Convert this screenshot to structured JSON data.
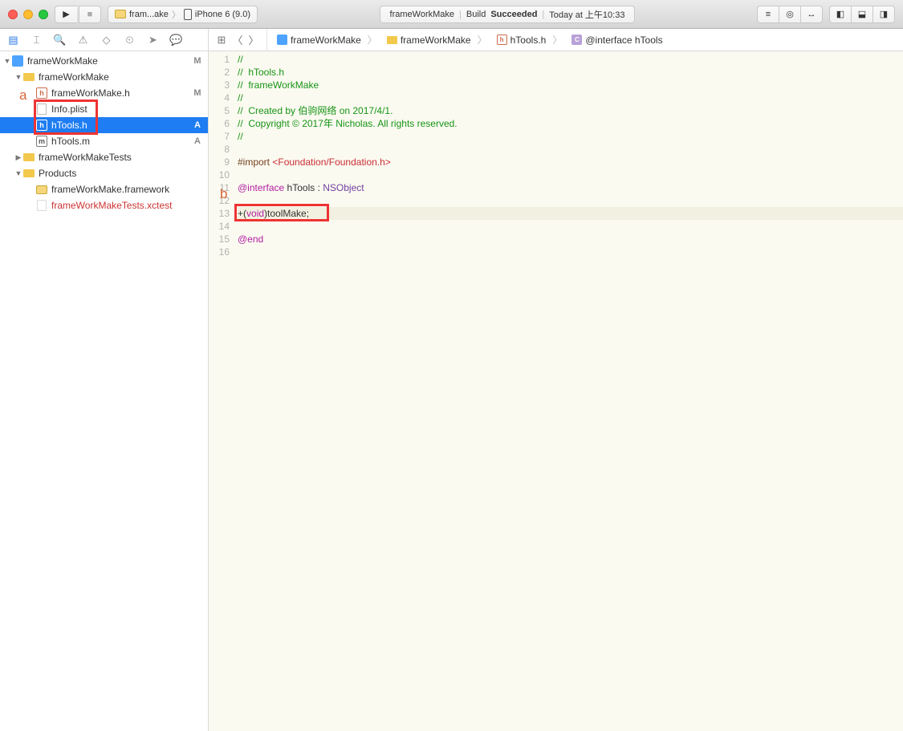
{
  "toolbar": {
    "run_icon": "▶",
    "stop_icon": "■",
    "scheme_project": "fram...ake",
    "scheme_device": "iPhone 6 (9.0)",
    "status_target": "frameWorkMake",
    "status_build_label": "Build",
    "status_build_result": "Succeeded",
    "status_time": "Today at 上午10:33"
  },
  "nav": {
    "project_name": "frameWorkMake",
    "project_status": "M",
    "items": [
      {
        "label": "frameWorkMake",
        "type": "folder",
        "indent": 1,
        "status": ""
      },
      {
        "label": "frameWorkMake.h",
        "type": "h",
        "indent": 2,
        "status": "M"
      },
      {
        "label": "Info.plist",
        "type": "plist",
        "indent": 2,
        "status": ""
      },
      {
        "label": "hTools.h",
        "type": "h",
        "indent": 2,
        "status": "A",
        "selected": true
      },
      {
        "label": "hTools.m",
        "type": "m",
        "indent": 2,
        "status": "A"
      },
      {
        "label": "frameWorkMakeTests",
        "type": "folder",
        "indent": 1,
        "status": ""
      },
      {
        "label": "Products",
        "type": "folder-gray",
        "indent": 1,
        "status": ""
      },
      {
        "label": "frameWorkMake.framework",
        "type": "fw",
        "indent": 2,
        "status": ""
      },
      {
        "label": "frameWorkMakeTests.xctest",
        "type": "xctest",
        "indent": 2,
        "status": "",
        "red": true
      }
    ]
  },
  "breadcrumb": {
    "items": [
      {
        "label": "frameWorkMake",
        "icon": "proj"
      },
      {
        "label": "frameWorkMake",
        "icon": "folder"
      },
      {
        "label": "hTools.h",
        "icon": "h"
      },
      {
        "label": "@interface hTools",
        "icon": "c"
      }
    ]
  },
  "editor": {
    "lines": {
      "l1": "//",
      "l2": "//  hTools.h",
      "l3": "//  frameWorkMake",
      "l4": "//",
      "l5": "//  Created by 伯驹网络 on 2017/4/1.",
      "l6": "//  Copyright © 2017年 Nicholas. All rights reserved.",
      "l7": "//",
      "l8": "",
      "l9_import": "#import",
      "l9_header": " <Foundation/Foundation.h>",
      "l10": "",
      "l11_at": "@interface",
      "l11_name": " hTools : ",
      "l11_super": "NSObject",
      "l12": "",
      "l13_plus": "+(",
      "l13_void": "void",
      "l13_rest": ")toolMake;",
      "l14": "",
      "l15": "@end",
      "l16": ""
    },
    "line_numbers": [
      "1",
      "2",
      "3",
      "4",
      "5",
      "6",
      "7",
      "8",
      "9",
      "10",
      "11",
      "12",
      "13",
      "14",
      "15",
      "16"
    ]
  },
  "annotations": {
    "a": "a",
    "b": "b"
  }
}
